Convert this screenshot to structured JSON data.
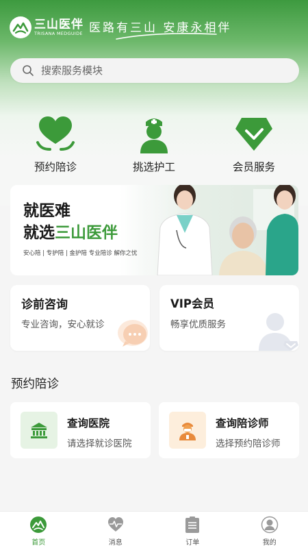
{
  "brand": {
    "name_cn": "三山医伴",
    "name_en": "TRISANA MEDGUIDE",
    "slogan": "医路有三山 安康永相伴"
  },
  "search": {
    "placeholder": "搜索服务模块",
    "icon": "search-icon"
  },
  "quick_actions": [
    {
      "label": "预约陪诊",
      "icon": "heart-hands-icon"
    },
    {
      "label": "挑选护工",
      "icon": "nurse-icon"
    },
    {
      "label": "会员服务",
      "icon": "gem-check-icon"
    }
  ],
  "banner": {
    "line1": "就医难",
    "line2_prefix": "就选",
    "line2_highlight": "三山医伴",
    "subtitle": "安心陪 | 专护陪 | 金护陪 专业陪诊 解你之忧"
  },
  "cards": {
    "consult": {
      "title": "诊前咨询",
      "desc": "专业咨询，安心就诊",
      "icon": "chat-bubble-icon"
    },
    "vip": {
      "title": "VIP会员",
      "desc": "畅享优质服务",
      "icon": "vip-user-icon"
    }
  },
  "section": {
    "title": "预约陪诊"
  },
  "escort_cards": {
    "hospital": {
      "title": "查询医院",
      "desc": "请选择就诊医院",
      "icon": "hospital-icon"
    },
    "escort": {
      "title": "查询陪诊师",
      "desc": "选择预约陪诊师",
      "icon": "escort-person-icon"
    }
  },
  "tabbar": [
    {
      "label": "首页",
      "icon": "home-logo-icon",
      "active": true
    },
    {
      "label": "消息",
      "icon": "heartbeat-icon",
      "active": false
    },
    {
      "label": "订单",
      "icon": "clipboard-icon",
      "active": false
    },
    {
      "label": "我的",
      "icon": "profile-icon",
      "active": false
    }
  ],
  "colors": {
    "brand_green": "#3c9a3a",
    "header_green": "#3d9a3f",
    "escort_orange": "#f0a050",
    "background": "#f5f5f5"
  }
}
